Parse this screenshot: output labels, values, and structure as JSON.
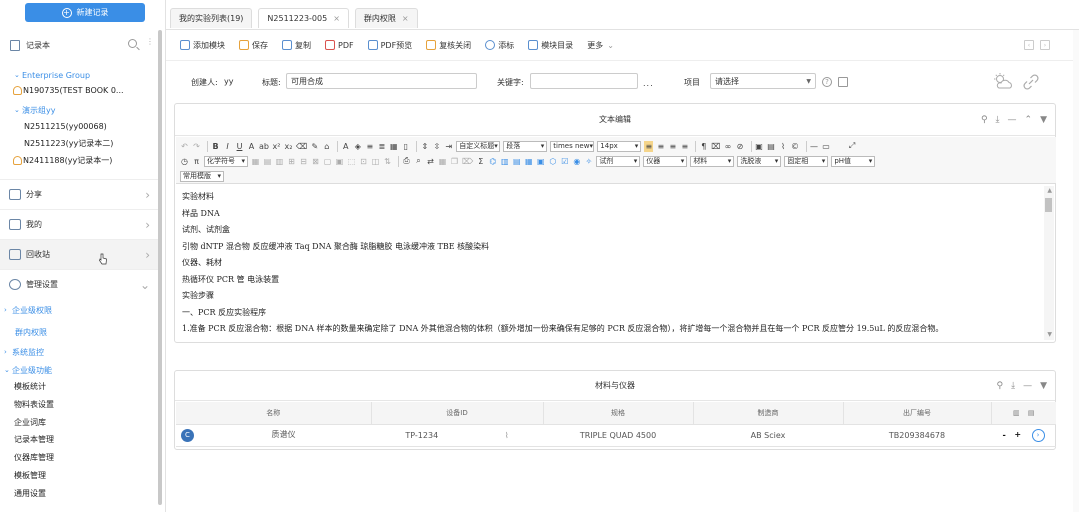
{
  "sidebar": {
    "new_record": "新建记录",
    "notebook": "记录本",
    "tree": [
      {
        "label": "Enterprise Group",
        "kind": "group"
      },
      {
        "label": "N190735(TEST BOOK 0...",
        "kind": "book"
      },
      {
        "label": "演示组yy",
        "kind": "group"
      },
      {
        "label": "N2511215(yy00068)",
        "kind": "item"
      },
      {
        "label": "N2511223(yy记录本二)",
        "kind": "item"
      },
      {
        "label": "N2411188(yy记录本一)",
        "kind": "book"
      }
    ],
    "menus": [
      {
        "label": "分享"
      },
      {
        "label": "我的"
      },
      {
        "label": "回收站"
      },
      {
        "label": "管理设置"
      }
    ],
    "settings": [
      {
        "label": "企业级权限",
        "kind": "parent"
      },
      {
        "label": "群内权限",
        "kind": "child"
      },
      {
        "label": "系统监控",
        "kind": "parent"
      },
      {
        "label": "企业级功能",
        "kind": "parent"
      },
      {
        "label": "模板统计",
        "kind": "leaf"
      },
      {
        "label": "物料表设置",
        "kind": "leaf"
      },
      {
        "label": "企业词库",
        "kind": "leaf"
      },
      {
        "label": "记录本管理",
        "kind": "leaf"
      },
      {
        "label": "仪器库管理",
        "kind": "leaf"
      },
      {
        "label": "模板管理",
        "kind": "leaf"
      },
      {
        "label": "通用设置",
        "kind": "leaf"
      }
    ]
  },
  "tabs": [
    {
      "label": "我的实验列表(19)",
      "closable": false
    },
    {
      "label": "N2511223-005",
      "closable": true
    },
    {
      "label": "群内权限",
      "closable": true
    }
  ],
  "toolbar": {
    "items": [
      "添加模块",
      "保存",
      "复制",
      "PDF",
      "PDF预览",
      "复核关闭",
      "添标",
      "模块目录",
      "更多"
    ]
  },
  "meta": {
    "creator_label": "创建人:",
    "creator_value": "yy",
    "title_label": "标题:",
    "title_value": "可用合成",
    "keyword_label": "关键字:",
    "keyword_value": "",
    "ellipsis": "...",
    "project_label": "项目",
    "project_value": "请选择"
  },
  "editor": {
    "title": "文本编辑",
    "toolbar": {
      "style_select": "自定义标题",
      "para_select": "段落",
      "font_select": "times new",
      "size_select": "14px",
      "r2_select": "化学符号",
      "r2_reagent": "试剂",
      "r2_instrument": "仪器",
      "r2_material": "材料",
      "r2_wash": "洗脱液",
      "r2_phase": "固定相",
      "r2_ph": "pH值",
      "r3_select": "常用模版"
    },
    "lines": [
      "实验材料",
      "样品 DNA",
      "试剂、试剂盒",
      "引物 dNTP 混合物 反应缓冲液 Taq DNA 聚合酶 琼脂糖胶 电泳缓冲液 TBE 核酸染料",
      "仪器、耗材",
      "热循环仪 PCR 管 电泳装置",
      "实验步骤",
      "一、PCR 反应实验程序",
      "1.准备 PCR 反应混合物：根据 DNA 样本的数量来确定除了 DNA 外其他混合物的体积（额外增加一份来确保有足够的 PCR 反应混合物），将扩增每一个混合物并且在每一个 PCR 反应管分 19.5uL 的反应混合物。"
    ]
  },
  "materials": {
    "title": "材料与仪器",
    "columns": [
      "名称",
      "设备ID",
      "规格",
      "制造商",
      "出厂编号"
    ],
    "rows": [
      {
        "badge": "C",
        "name": "质谱仪",
        "id": "TP-1234",
        "spec": "TRIPLE QUAD 4500",
        "maker": "AB Sciex",
        "serial": "TB209384678",
        "minus": "-",
        "plus": "+"
      }
    ]
  },
  "colors": {
    "accent": "#3a8ee6",
    "badge": "#3a73b8"
  }
}
